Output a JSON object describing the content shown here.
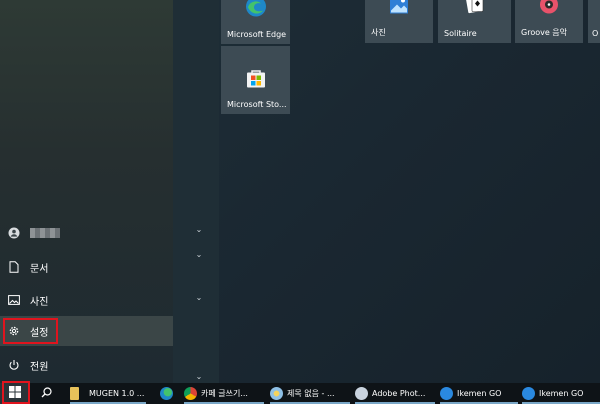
{
  "start_menu": {
    "rail": {
      "user_name": "",
      "documents": "문서",
      "pictures": "사진",
      "settings": "설정",
      "power": "전원"
    }
  },
  "tiles": {
    "edge": "Microsoft Edge",
    "photos": "사진",
    "solitaire": "Solitaire",
    "groove": "Groove 음악",
    "store": "Microsoft Sto..."
  },
  "taskbar": {
    "items": [
      {
        "label": "MUGEN 1.0 ..."
      },
      {
        "label": "카페 글쓰기..."
      },
      {
        "label": "제목 없음 - ..."
      },
      {
        "label": "Adobe Phot..."
      },
      {
        "label": "Ikemen GO"
      },
      {
        "label": "Ikemen GO"
      }
    ]
  },
  "colors": {
    "highlight": "#e0141e",
    "accent": "#7aa7c7"
  }
}
